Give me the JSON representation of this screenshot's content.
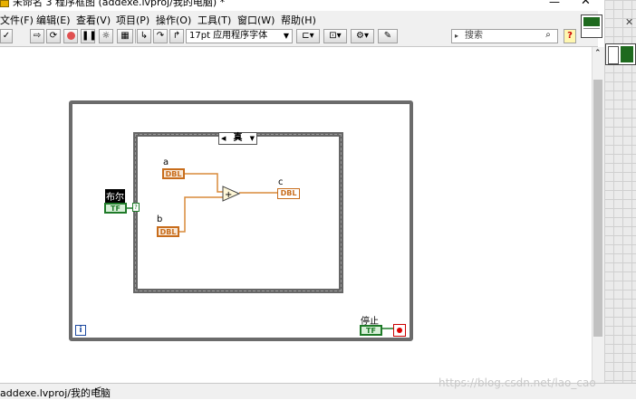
{
  "title_bar": {
    "title": "未命名 3 程序框图 (addexe.lvproj/我的电脑) *",
    "minimize": "—",
    "close": "✕"
  },
  "menu": {
    "items": [
      "文件(F)",
      "编辑(E)",
      "查看(V)",
      "项目(P)",
      "操作(O)",
      "工具(T)",
      "窗口(W)",
      "帮助(H)"
    ]
  },
  "toolbar": {
    "font": "17pt 应用程序字体",
    "search_placeholder": "搜索",
    "help": "?"
  },
  "diagram": {
    "case_selector": "真",
    "control_a_label": "a",
    "control_b_label": "b",
    "indicator_c_label": "c",
    "dbl": "DBL",
    "bool_control_label": "布尔",
    "tf": "TF",
    "stop_label": "停止",
    "iteration": "i",
    "add_symbol": "+"
  },
  "status": {
    "path": "addexe.lvproj/我的电脑",
    "watermark": "https://blog.csdn.net/lao_cao"
  },
  "right_pane": {
    "close": "✕"
  },
  "colors": {
    "orange_wire": "#d98a3a",
    "green_bool": "#1e7a28",
    "structure_gray": "#6b6b6b"
  }
}
